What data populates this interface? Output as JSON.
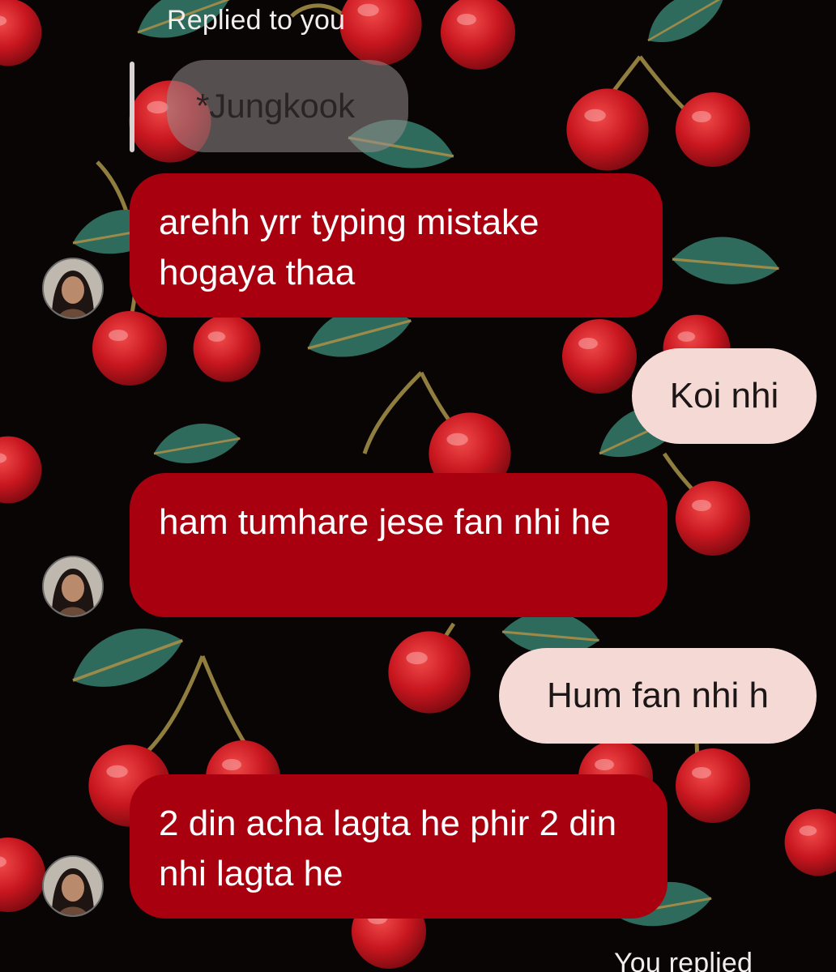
{
  "thread": {
    "reply_caption_top": "Replied to you",
    "quoted_message": "*Jungkook",
    "reply_caption_bottom": "You replied"
  },
  "messages": [
    {
      "from": "them",
      "text": "arehh yrr typing mistake hogaya thaa"
    },
    {
      "from": "me",
      "text": "Koi nhi"
    },
    {
      "from": "them",
      "text": "ham tumhare jese fan nhi he"
    },
    {
      "from": "me",
      "text": "Hum fan nhi h"
    },
    {
      "from": "them",
      "text": "2 din acha lagta he phir 2 din nhi lagta he"
    }
  ],
  "colors": {
    "background": "#0a0505",
    "incoming_bubble": "#a8000f",
    "outgoing_bubble": "#f5d9d5",
    "cherry": "#c8161f",
    "leaf": "#2f6b5c"
  },
  "icons": {
    "avatar": "profile-photo-avatar"
  }
}
